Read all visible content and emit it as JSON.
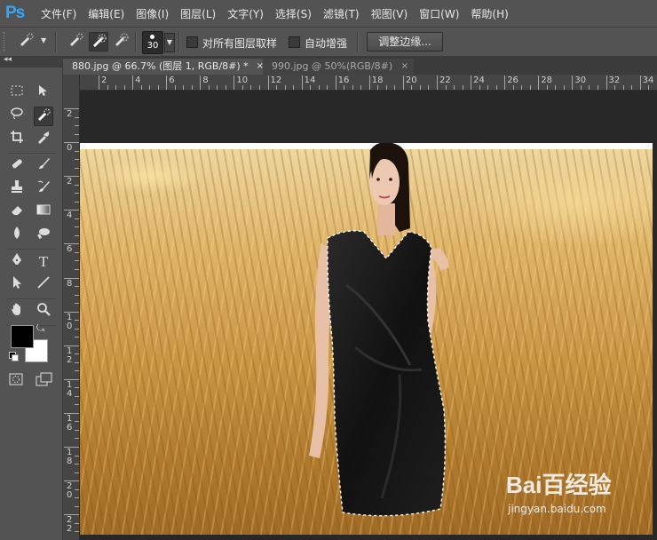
{
  "app": {
    "logo": "Ps"
  },
  "menu": [
    "文件(F)",
    "编辑(E)",
    "图像(I)",
    "图层(L)",
    "文字(Y)",
    "选择(S)",
    "滤镜(T)",
    "视图(V)",
    "窗口(W)",
    "帮助(H)"
  ],
  "options": {
    "brush_size": "30",
    "sample_all_layers_label": "对所有图层取样",
    "sample_all_layers_checked": false,
    "auto_enhance_label": "自动增强",
    "auto_enhance_checked": false,
    "refine_edge_label": "调整边缘..."
  },
  "tabs": [
    {
      "label": "880.jpg @ 66.7% (图层 1, RGB/8#) *",
      "active": true,
      "close": "×"
    },
    {
      "label": "990.jpg @ 50%(RGB/8#)",
      "active": false,
      "close": "×"
    }
  ],
  "rulers": {
    "horizontal": [
      "2",
      "4",
      "6",
      "8",
      "10",
      "12",
      "14",
      "16",
      "18",
      "20",
      "22",
      "24",
      "26",
      "28",
      "30",
      "32",
      "34"
    ],
    "vertical": [
      "2",
      "0",
      "2",
      "4",
      "6",
      "8",
      "10",
      "12",
      "14",
      "16",
      "18",
      "20",
      "22"
    ]
  },
  "tools": [
    "marquee-icon",
    "move-icon",
    "lasso-icon",
    "quick-selection-icon",
    "crop-icon",
    "eyedropper-icon",
    "healing-brush-icon",
    "brush-icon",
    "clone-stamp-icon",
    "history-brush-icon",
    "eraser-icon",
    "gradient-icon",
    "blur-icon",
    "dodge-icon",
    "pen-icon",
    "type-icon",
    "path-selection-icon",
    "line-icon",
    "hand-icon",
    "zoom-icon"
  ],
  "colors": {
    "foreground": "#000000",
    "background": "#ffffff",
    "accent": "#31a8ff"
  },
  "watermark": {
    "logo": "Bai百经验",
    "url": "jingyan.baidu.com"
  }
}
